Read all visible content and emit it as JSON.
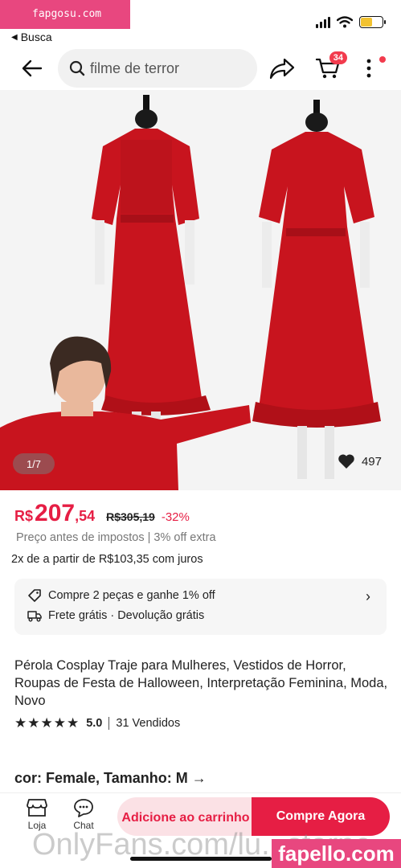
{
  "watermarks": {
    "top_left": "fapgosu.com",
    "bottom_center": "OnlyFans.com/lu...starne",
    "bottom_right": "fapello.com"
  },
  "status_bar": {
    "icons": [
      "signal-icon",
      "wifi-icon",
      "battery-icon"
    ]
  },
  "nav": {
    "back_app_label": "Busca",
    "search_placeholder": "filme de terror",
    "cart_count": "34"
  },
  "gallery": {
    "counter": "1/7",
    "likes": "497"
  },
  "price": {
    "currency": "R$",
    "integer": "207",
    "cents": ",54",
    "original": "R$305,19",
    "discount": "-32%",
    "tax_note": "Preço antes de impostos | 3% off extra",
    "installment": "2x de a partir de R$103,35 com juros"
  },
  "promo": {
    "line1": "Compre 2 peças e ganhe 1% off",
    "line2": "Frete grátis · Devolução grátis"
  },
  "product": {
    "title": "Pérola Cosplay Traje para Mulheres, Vestidos de Horror, Roupas de Festa de Halloween, Interpretação Feminina, Moda, Novo",
    "rating": "5.0",
    "rating_stars": 5,
    "sold": "31 Vendidos",
    "variant": "cor: Female, Tamanho: M →"
  },
  "bottom_bar": {
    "store_label": "Loja",
    "chat_label": "Chat",
    "add_to_cart": "Adicione ao carrinho",
    "buy_now": "Compre Agora"
  },
  "colors": {
    "accent": "#e61e44",
    "dress_red": "#c8141e",
    "watermark_pink": "#e8477f"
  }
}
